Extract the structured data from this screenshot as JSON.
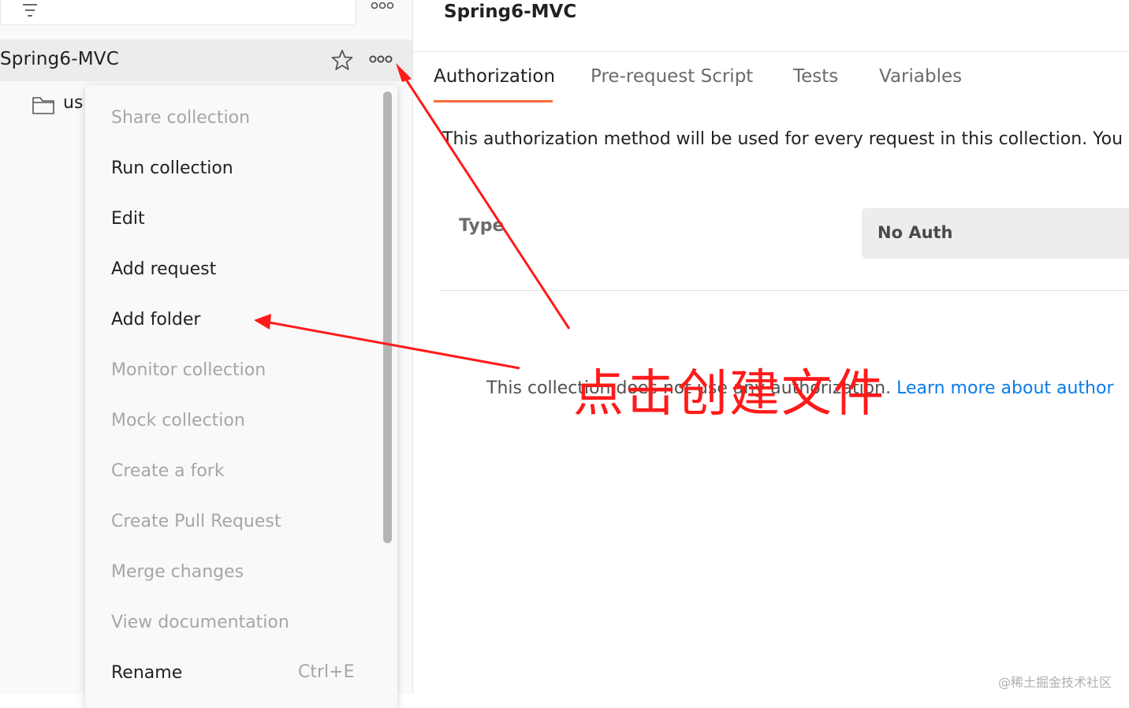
{
  "sidebar": {
    "collection_name": "Spring6-MVC",
    "folder_label": "us"
  },
  "menu": {
    "items": [
      {
        "label": "Share collection",
        "enabled": false
      },
      {
        "label": "Run collection",
        "enabled": true
      },
      {
        "label": "Edit",
        "enabled": true
      },
      {
        "label": "Add request",
        "enabled": true
      },
      {
        "label": "Add folder",
        "enabled": true
      },
      {
        "label": "Monitor collection",
        "enabled": false
      },
      {
        "label": "Mock collection",
        "enabled": false
      },
      {
        "label": "Create a fork",
        "enabled": false
      },
      {
        "label": "Create Pull Request",
        "enabled": false
      },
      {
        "label": "Merge changes",
        "enabled": false
      },
      {
        "label": "View documentation",
        "enabled": false
      },
      {
        "label": "Rename",
        "enabled": true
      }
    ],
    "rename_shortcut": "Ctrl+E"
  },
  "main": {
    "title": "Spring6-MVC",
    "tabs": [
      {
        "label": "Authorization",
        "active": true
      },
      {
        "label": "Pre-request Script",
        "active": false
      },
      {
        "label": "Tests",
        "active": false
      },
      {
        "label": "Variables",
        "active": false
      }
    ],
    "description": "This authorization method will be used for every request in this collection. You",
    "type_label": "Type",
    "auth_type": "No Auth",
    "info_text": "This collection does not use any authorization. ",
    "info_link": "Learn more about author"
  },
  "annotation": {
    "text": "点击创建文件",
    "color": "#ff1a1a"
  },
  "watermark": "@稀土掘金技术社区",
  "colors": {
    "accent": "#ff6c37",
    "link": "#097bed",
    "annotation": "#ff1a1a"
  },
  "icons": [
    "filter-icon",
    "more-icon",
    "star-icon",
    "folder-icon"
  ]
}
